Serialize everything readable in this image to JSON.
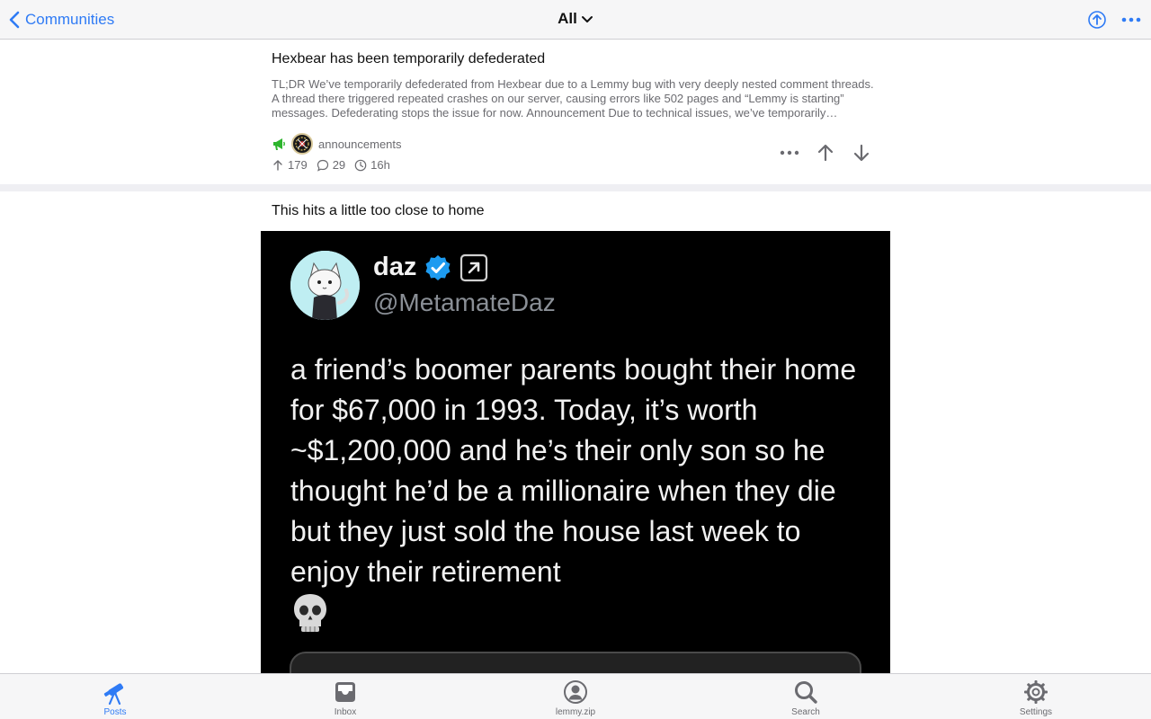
{
  "nav": {
    "back_label": "Communities",
    "title": "All"
  },
  "posts": [
    {
      "title": "Hexbear has been temporarily defederated",
      "body": "TL;DR We’ve temporarily defederated from Hexbear due to a Lemmy bug with very deeply nested comment threads. A thread there triggered repeated crashes on our server, causing errors like 502 pages and “Lemmy is starting” messages. Defederating stops the issue for now. Announcement Due to technical issues, we’ve temporarily…",
      "community": "announcements",
      "upvotes": "179",
      "comments": "29",
      "age": "16h"
    },
    {
      "title": "This hits a little too close to home",
      "image": {
        "display_name": "daz",
        "handle": "@MetamateDaz",
        "text": "a friend’s boomer parents bought their home for $67,000 in 1993. Today, it’s worth ~$1,200,000 and he’s their only son so he thought he’d be a millionaire when they die but they just sold the house last week to enjoy their retirement"
      }
    }
  ],
  "tabs": [
    {
      "label": "Posts",
      "icon": "telescope-icon",
      "active": true
    },
    {
      "label": "Inbox",
      "icon": "inbox-tray-icon",
      "active": false
    },
    {
      "label": "lemmy.zip",
      "icon": "account-circle-icon",
      "active": false
    },
    {
      "label": "Search",
      "icon": "magnifier-icon",
      "active": false
    },
    {
      "label": "Settings",
      "icon": "gear-icon",
      "active": false
    }
  ],
  "colors": {
    "accent": "#2f7bf5",
    "muted_text": "#6b6b70",
    "announcement_green": "#2db52d"
  }
}
